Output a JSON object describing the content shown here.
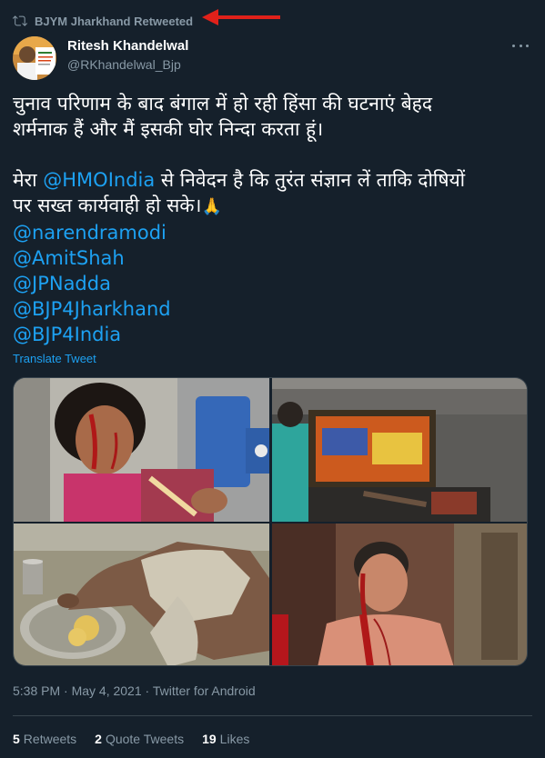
{
  "retweet": {
    "icon": "retweet-icon",
    "text": "BJYM Jharkhand Retweeted"
  },
  "annotation": {
    "icon": "red-arrow-pointer",
    "color": "#e0211a"
  },
  "author": {
    "name": "Ritesh Khandelwal",
    "handle": "@RKhandelwal_Bjp"
  },
  "tweet": {
    "line1": "चुनाव परिणाम के बाद बंगाल में हो रही हिंसा की घटनाएं बेहद",
    "line2": "शर्मनाक हैं और मैं इसकी घोर निन्दा करता हूं।",
    "line3_prefix": "मेरा ",
    "line3_mention": "@HMOIndia",
    "line3_suffix": " से निवेदन है कि तुरंत संज्ञान लें ताकि दोषियों",
    "line4": "पर सख्त कार्यवाही हो सके।",
    "emoji": "🙏",
    "mentions": [
      "@narendramodi",
      "@AmitShah",
      "@JPNadda",
      "@BJP4Jharkhand",
      "@BJP4India"
    ],
    "translate_label": "Translate Tweet"
  },
  "media": [
    {
      "name": "photo-injured-woman"
    },
    {
      "name": "photo-vandalized-room"
    },
    {
      "name": "photo-elderly-woman-eating"
    },
    {
      "name": "photo-injured-man"
    }
  ],
  "meta": {
    "timestamp": "5:38 PM · May 4, 2021 · Twitter for Android"
  },
  "stats": {
    "retweets_count": "5",
    "retweets_label": "Retweets",
    "quotes_count": "2",
    "quotes_label": "Quote Tweets",
    "likes_count": "19",
    "likes_label": "Likes"
  },
  "colors": {
    "background": "#15202b",
    "link": "#1da1f2",
    "muted": "#8899a6",
    "divider": "#38444d"
  }
}
